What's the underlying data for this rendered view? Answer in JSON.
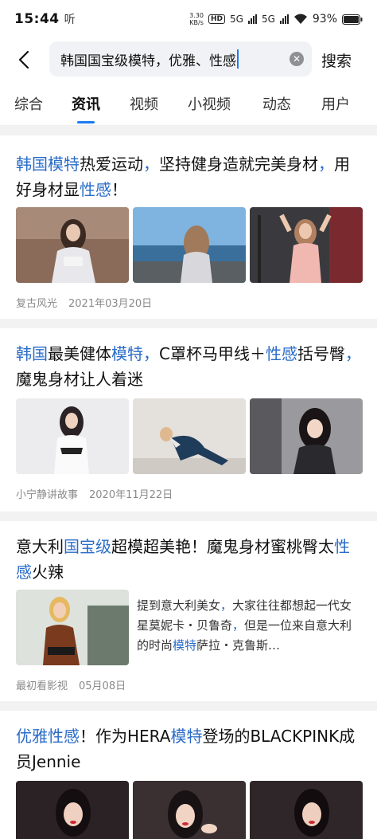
{
  "status": {
    "time": "15:44",
    "extra": "听",
    "speed_top": "3.30",
    "speed_bottom": "KB/s",
    "hd": "HD",
    "net1": "5G",
    "net2": "5G",
    "battery": "93%"
  },
  "search": {
    "query": "韩国国宝级模特，优雅、性感",
    "button_label": "搜索"
  },
  "tabs": [
    "综合",
    "资讯",
    "视频",
    "小视频",
    "动态",
    "用户"
  ],
  "active_tab": "资讯",
  "articles": [
    {
      "title_parts": [
        {
          "text": "韩国",
          "hl": true
        },
        {
          "text": "模特",
          "hl": true
        },
        {
          "text": "热爱运动",
          "hl": false
        },
        {
          "text": "，",
          "hl": true
        },
        {
          "text": "坚持健身造就完美身材",
          "hl": false
        },
        {
          "text": "，",
          "hl": true
        },
        {
          "text": "用好身材显",
          "hl": false
        },
        {
          "text": "性感",
          "hl": true
        },
        {
          "text": "！",
          "hl": false
        }
      ],
      "source": "复古风光",
      "date": "2021年03月20日"
    },
    {
      "title_parts": [
        {
          "text": "韩国",
          "hl": true
        },
        {
          "text": "最美健体",
          "hl": false
        },
        {
          "text": "模特",
          "hl": true
        },
        {
          "text": "，",
          "hl": true
        },
        {
          "text": "C罩杯马甲线＋",
          "hl": false
        },
        {
          "text": "性感",
          "hl": true
        },
        {
          "text": "括号臀",
          "hl": false
        },
        {
          "text": "，",
          "hl": true
        },
        {
          "text": "魔鬼身材让人着迷",
          "hl": false
        }
      ],
      "source": "小宁静讲故事",
      "date": "2020年11月22日"
    },
    {
      "title_parts": [
        {
          "text": "意大利",
          "hl": false
        },
        {
          "text": "国宝级",
          "hl": true
        },
        {
          "text": "超模超美艳！魔鬼身材蜜桃臀太",
          "hl": false
        },
        {
          "text": "性感",
          "hl": true
        },
        {
          "text": "火辣",
          "hl": false
        }
      ],
      "summary_parts": [
        {
          "text": "提到意大利美女",
          "hl": false
        },
        {
          "text": "，",
          "hl": true
        },
        {
          "text": "大家往往都想起一代女星莫妮卡・贝鲁奇",
          "hl": false
        },
        {
          "text": "，",
          "hl": true
        },
        {
          "text": "但是一位来自意大利的时尚",
          "hl": false
        },
        {
          "text": "模特",
          "hl": true
        },
        {
          "text": "萨拉・克鲁斯…",
          "hl": false
        }
      ],
      "source": "最初看影视",
      "date": "05月08日"
    },
    {
      "title_parts": [
        {
          "text": "优雅",
          "hl": true
        },
        {
          "text": "性感",
          "hl": true
        },
        {
          "text": "！作为HERA",
          "hl": false
        },
        {
          "text": "模特",
          "hl": true
        },
        {
          "text": "登场的BLACKPINK成员Jennie",
          "hl": false
        }
      ]
    }
  ],
  "colors": {
    "accent": "#1a7cf5",
    "highlight": "#2a6cc8",
    "meta": "#8a8a8a"
  }
}
